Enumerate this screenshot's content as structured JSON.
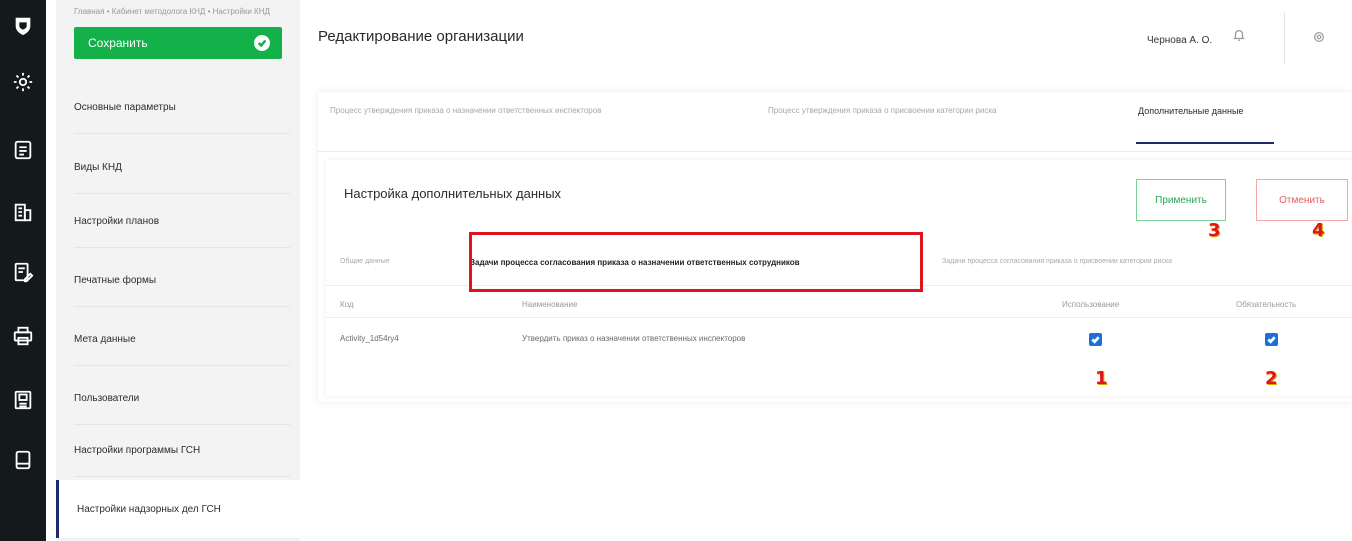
{
  "rail": {
    "icons": [
      "shield-logo-icon",
      "settings-gear-icon",
      "document-icon",
      "building-icon",
      "form-edit-icon",
      "printer-icon",
      "archive-icon",
      "book-icon"
    ]
  },
  "breadcrumb": {
    "items": [
      "Главная",
      "Кабинет методолога КНД",
      "Настройки КНД"
    ]
  },
  "header": {
    "title": "Редактирование организации",
    "user": "Чернова А. О."
  },
  "sidebar": {
    "save_label": "Сохранить",
    "items": [
      {
        "label": "Основные параметры"
      },
      {
        "label": "Виды КНД"
      },
      {
        "label": "Настройки планов"
      },
      {
        "label": "Печатные формы"
      },
      {
        "label": "Мета данные"
      },
      {
        "label": "Пользователи"
      },
      {
        "label": "Настройки программы ГСН"
      },
      {
        "label": "Настройки надзорных дел ГСН"
      }
    ]
  },
  "tabs": [
    {
      "label": "Процесс утверждения приказа о назначении ответственных инспекторов"
    },
    {
      "label": "Процесс утверждения приказа о присвоении категории риска"
    },
    {
      "label": "Дополнительные данные"
    }
  ],
  "panel": {
    "title": "Настройка дополнительных данных",
    "apply_label": "Применить",
    "cancel_label": "Отменить"
  },
  "subtabs": [
    {
      "label": "Общие данные"
    },
    {
      "label": "Задачи процесса согласования приказа о назначении ответственных сотрудников"
    },
    {
      "label": "Задачи процесса согласования приказа о присвоении категории риска"
    }
  ],
  "table": {
    "columns": [
      "Код",
      "Наименование",
      "Использование",
      "Обязательность"
    ],
    "rows": [
      {
        "code": "Activity_1d54ry4",
        "name": "Утвердить приказ о назначении ответственных инспекторов",
        "use": true,
        "required": true
      }
    ]
  },
  "annotations": [
    "1",
    "2",
    "3",
    "4"
  ],
  "colors": {
    "accent_green": "#14b04a",
    "accent_navy": "#1f2a6e",
    "checkbox_blue": "#1e6fd9",
    "annotation_red": "#e0141e"
  }
}
